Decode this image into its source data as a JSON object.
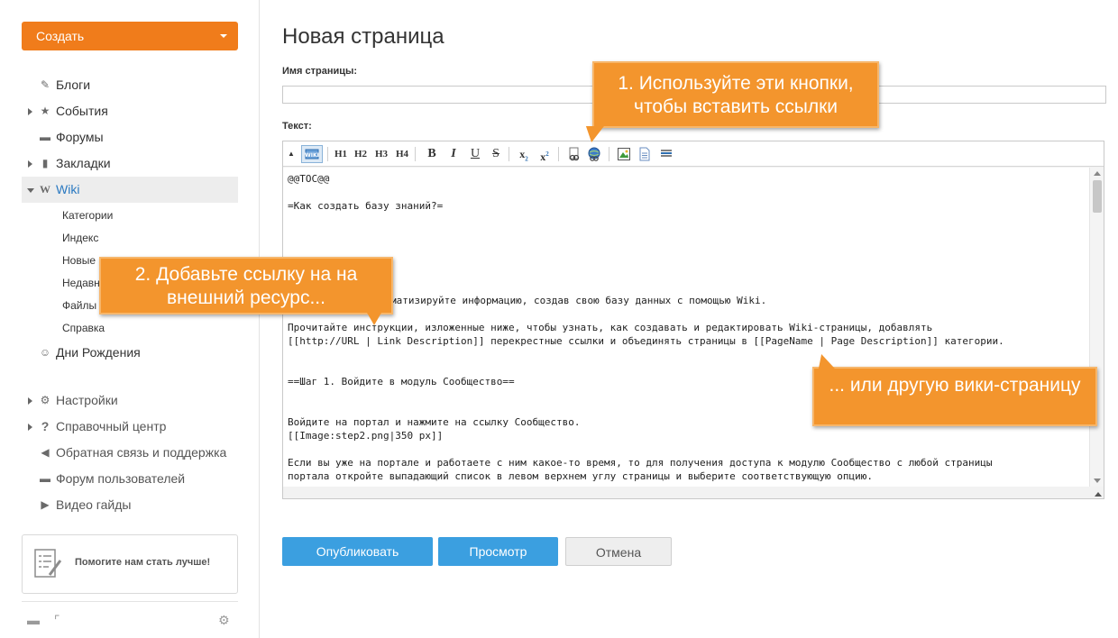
{
  "sidebar": {
    "create_label": "Создать",
    "items": [
      {
        "label": "Блоги",
        "icon": "blog-icon"
      },
      {
        "label": "События",
        "icon": "events-icon"
      },
      {
        "label": "Форумы",
        "icon": "forum-icon"
      },
      {
        "label": "Закладки",
        "icon": "bookmark-icon"
      },
      {
        "label": "Wiki",
        "icon": "wiki-icon"
      }
    ],
    "wiki_subitems": [
      "Категории",
      "Индекс",
      "Новые",
      "Недавние",
      "Файлы",
      "Справка"
    ],
    "birthdays": "Дни Рождения",
    "bottom_items": [
      {
        "label": "Настройки",
        "icon": "gear-icon"
      },
      {
        "label": "Справочный центр",
        "icon": "question-icon"
      },
      {
        "label": "Обратная связь и поддержка",
        "icon": "megaphone-icon"
      },
      {
        "label": "Форум пользователей",
        "icon": "chat-icon"
      },
      {
        "label": "Видео гайды",
        "icon": "video-icon"
      }
    ],
    "help_box_text": "Помогите нам стать лучше!"
  },
  "main": {
    "title": "Новая страница",
    "page_name_label": "Имя страницы:",
    "page_name_value": "",
    "text_label": "Текст:",
    "toolbar": {
      "headings": [
        "H1",
        "H2",
        "H3",
        "H4"
      ],
      "format": [
        "B",
        "I",
        "U",
        "S"
      ]
    },
    "editor_lines": [
      "@@TOC@@",
      "=Как создать базу знаний?=",
      "матизируйте информацию, создав свою базу данных с помощью Wiki.",
      "Прочитайте инструкции, изложенные ниже, чтобы узнать, как создавать и редактировать Wiki-страницы, добавлять",
      "[[http://URL | Link Description]] перекрестные ссылки и объединять страницы в [[PageName | Page Description]] категории.",
      "==Шаг 1. Войдите в модуль Сообщество==",
      "Войдите на портал и нажмите на ссылку Сообщество.",
      "[[Image:step2.png|350 px]]",
      "Если вы уже на портале и работаете с ним какое-то время, то для получения доступа к модулю Сообщество с любой страницы",
      "портала откройте выпадающий список в левом верхнем углу страницы и выберите соответствующую опцию."
    ],
    "buttons": {
      "publish": "Опубликовать",
      "preview": "Просмотр",
      "cancel": "Отмена"
    }
  },
  "callouts": {
    "c1": "1. Используйте эти кнопки, чтобы вставить ссылки",
    "c2": "2. Добавьте ссылку на на внешний ресурс...",
    "c3": "... или другую вики-страницу"
  },
  "colors": {
    "accent_orange": "#f07c1b",
    "primary_blue": "#3b9fe0",
    "callout": "#f3952d",
    "wiki_active": "#2a79c1"
  }
}
